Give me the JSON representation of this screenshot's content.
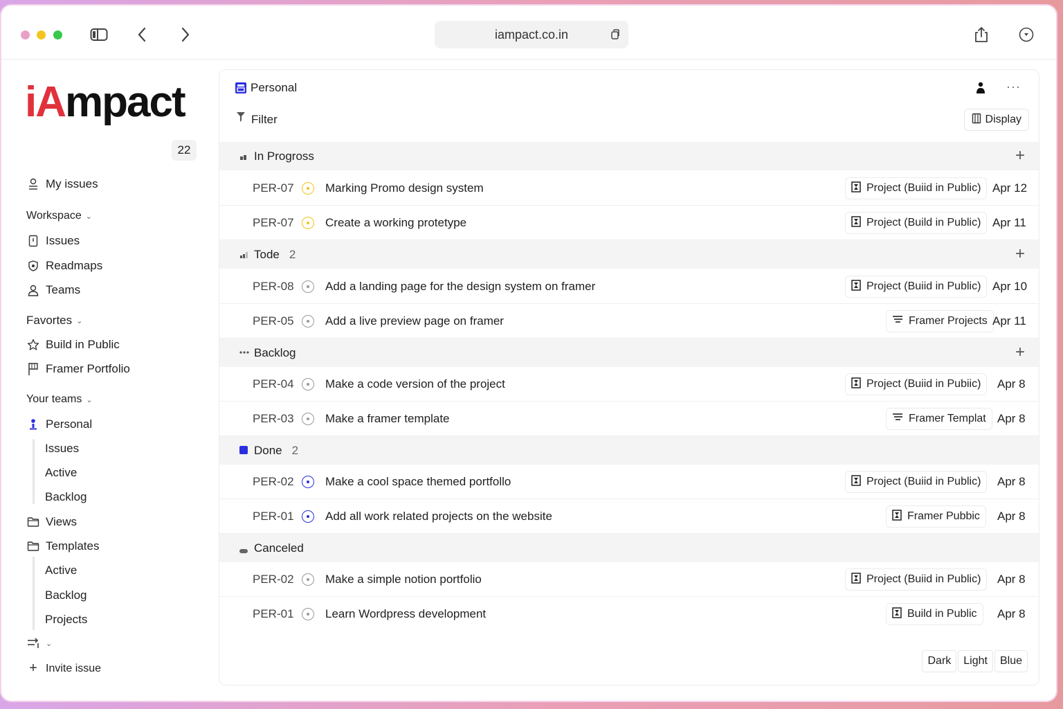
{
  "browser": {
    "url": "iampact.co.in",
    "traffic_colors": {
      "close": "#e8a0c7",
      "minimize": "#f4c521",
      "maximize": "#38c94a"
    }
  },
  "sidebar": {
    "logo_prefix": "iA",
    "logo_suffix": "mpact",
    "count": "22",
    "my_issues": "My issues",
    "workspace": {
      "label": "Workspace",
      "items": [
        "Issues",
        "Readmaps",
        "Teams"
      ]
    },
    "favorites": {
      "label": "Favortes",
      "items": [
        "Build in Public",
        "Framer Portfolio"
      ]
    },
    "your_teams": {
      "label": "Your teams",
      "team": "Personal",
      "sub_items": [
        "Issues",
        "Active",
        "Backlog"
      ]
    },
    "views": "Views",
    "templates": {
      "label": "Templates",
      "sub_items": [
        "Active",
        "Backlog",
        "Projects"
      ]
    },
    "invite": "Invite issue"
  },
  "main": {
    "title": "Personal",
    "filter": "Filter",
    "display": "Display",
    "accent": "#2b2fe0",
    "groups": [
      {
        "label": "In Progross",
        "count": "",
        "rows": [
          {
            "id": "PER-07",
            "status": "yellow",
            "title": "Marking Promo design system",
            "chip": "Project (Buiid in Public)",
            "chip_icon": "project-icon",
            "date": "Apr 12"
          },
          {
            "id": "PER-07",
            "status": "yellow",
            "title": "Create a working protetype",
            "chip": "Project (Build in Public)",
            "chip_icon": "project-icon",
            "date": "Apr 11"
          }
        ]
      },
      {
        "label": "Tode",
        "count": "2",
        "rows": [
          {
            "id": "PER-08",
            "status": "gray",
            "title": "Add a landing page for the design system on framer",
            "chip": "Project (Buiid in Public)",
            "chip_icon": "project-icon",
            "date": "Apr 10"
          },
          {
            "id": "PER-05",
            "status": "gray",
            "title": "Add a live preview page on framer",
            "chip": "Framer Projects",
            "chip_icon": "list-icon",
            "date": "Apr 11"
          }
        ]
      },
      {
        "label": "Backlog",
        "count": "",
        "rows": [
          {
            "id": "PER-04",
            "status": "gray",
            "title": "Make a code version of the project",
            "chip": "Project (Buiid in Pubiic)",
            "chip_icon": "project-icon",
            "date": "Apr 8"
          },
          {
            "id": "PER-03",
            "status": "gray",
            "title": "Make a framer template",
            "chip": "Framer Templat",
            "chip_icon": "list-icon",
            "date": "Apr 8"
          }
        ]
      },
      {
        "label": "Done",
        "count": "2",
        "rows": [
          {
            "id": "PER-02",
            "status": "blue",
            "title": "Make a cool space themed portfollo",
            "chip": "Project (Buiid in Public)",
            "chip_icon": "project-icon",
            "date": "Apr 8"
          },
          {
            "id": "PER-01",
            "status": "blue",
            "title": "Add all work related projects on the website",
            "chip": "Framer Pubbic",
            "chip_icon": "project-icon",
            "date": "Apr 8"
          }
        ]
      },
      {
        "label": "Canceled",
        "count": "",
        "rows": [
          {
            "id": "PER-02",
            "status": "gray",
            "title": "Make a simple notion portfolio",
            "chip": "Project (Buiid in Public)",
            "chip_icon": "project-icon",
            "date": "Apr 8"
          },
          {
            "id": "PER-01",
            "status": "gray",
            "title": "Learn Wordpress development",
            "chip": "Build in Public",
            "chip_icon": "project-icon",
            "date": "Apr 8"
          }
        ]
      }
    ],
    "themes": [
      "Dark",
      "Light",
      "Blue"
    ]
  }
}
